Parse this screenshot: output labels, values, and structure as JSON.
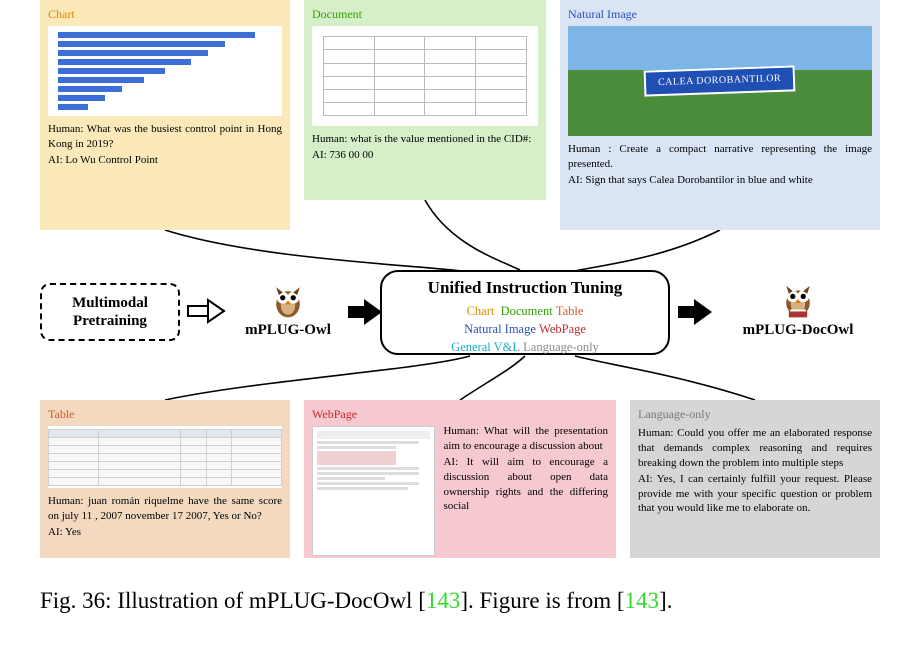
{
  "cards": {
    "chart": {
      "label": "Chart",
      "human": "Human: What was the busiest control point in Hong Kong in 2019?",
      "ai": "AI: Lo Wu Control Point"
    },
    "document": {
      "label": "Document",
      "human": "Human: what is the value mentioned in the CID#:",
      "ai": "AI: 736 00 00"
    },
    "natural": {
      "label": "Natural Image",
      "sign_text": "CALEA DOROBANTILOR",
      "human": "Human : Create a compact narrative representing the image presented.",
      "ai": "AI: Sign that says Calea Dorobantilor in blue and white"
    },
    "table": {
      "label": "Table",
      "human": "Human: juan román riquelme have the same score on july 11 , 2007 november 17 2007, Yes or No?",
      "ai": "AI: Yes"
    },
    "webpage": {
      "label": "WebPage",
      "human": "Human: What will the presentation aim to encourage a discussion about",
      "ai": "AI: It will aim to encourage a discussion about open data ownership rights and the differing social"
    },
    "language": {
      "label": "Language-only",
      "human": "Human: Could you offer me an elaborated response that demands complex reasoning and requires breaking down the problem into multiple steps",
      "ai": "AI: Yes, I can certainly fulfill your request. Please provide me with your specific question or problem that you would like me to elaborate on."
    }
  },
  "middle": {
    "pretrain": "Multimodal Pretraining",
    "model1": "mPLUG-Owl",
    "model2": "mPLUG-DocOwl",
    "unified_title": "Unified Instruction Tuning",
    "tags": {
      "chart": "Chart",
      "document": "Document",
      "table": "Table",
      "natural": "Natural Image",
      "webpage": "WebPage",
      "general": "General V&L",
      "language": "Language-only"
    }
  },
  "caption": {
    "prefix": "Fig. 36: Illustration of mPLUG-DocOwl [",
    "ref1": "143",
    "mid": "]. Figure is from [",
    "ref2": "143",
    "suffix": "]."
  }
}
